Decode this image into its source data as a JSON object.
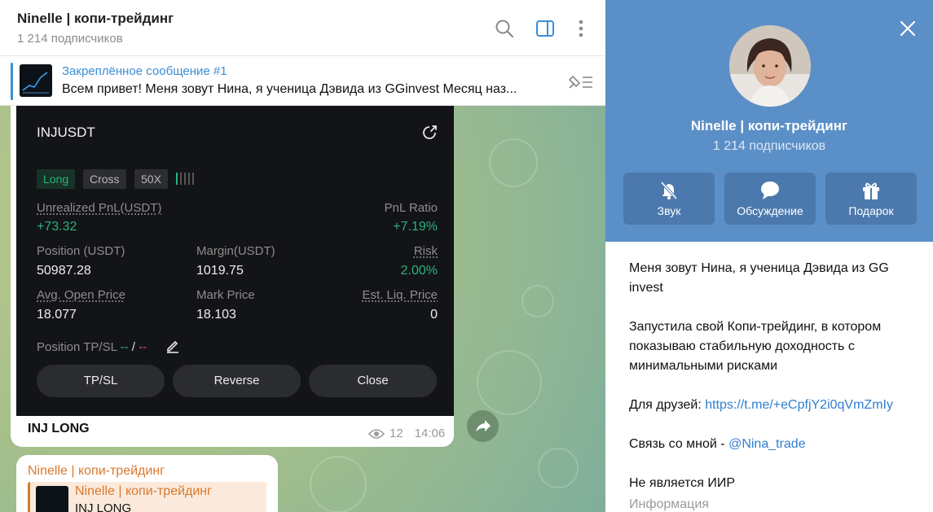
{
  "chat": {
    "title": "Ninelle | копи-трейдинг",
    "subscribers": "1 214 подписчиков"
  },
  "pinned": {
    "title": "Закреплённое сообщение #1",
    "text": "Всем привет! Меня зовут Нина, я ученица Дэвида из GGinvest   Месяц наз..."
  },
  "trade": {
    "symbol": "INJUSDT",
    "tags": [
      "Long",
      "Cross",
      "50X"
    ],
    "unrealized_label": "Unrealized PnL(USDT)",
    "unrealized_value": "+73.32",
    "pnl_ratio_label": "PnL Ratio",
    "pnl_ratio_value": "+7.19%",
    "position_label": "Position (USDT)",
    "position_value": "50987.28",
    "margin_label": "Margin(USDT)",
    "margin_value": "1019.75",
    "risk_label": "Risk",
    "risk_value": "2.00%",
    "avg_open_label": "Avg. Open Price",
    "avg_open_value": "18.077",
    "mark_label": "Mark Price",
    "mark_value": "18.103",
    "liq_label": "Est. Liq. Price",
    "liq_value": "0",
    "tpsl_label": "Position TP/SL",
    "tpsl_tp": "--",
    "tpsl_sep": "/",
    "tpsl_sl": "--",
    "buttons": [
      "TP/SL",
      "Reverse",
      "Close"
    ]
  },
  "message": {
    "caption": "INJ LONG",
    "views": "12",
    "time": "14:06"
  },
  "next_message": {
    "author": "Ninelle | копи-трейдинг",
    "reply_name": "Ninelle | копи-трейдинг",
    "reply_text": "INJ LONG"
  },
  "panel": {
    "name": "Ninelle | копи-трейдинг",
    "subscribers": "1 214 подписчиков",
    "buttons": [
      "Звук",
      "Обсуждение",
      "Подарок"
    ],
    "about1": "Меня зовут Нина, я ученица Дэвида из GG invest",
    "about2": "Запустила свой Копи-трейдинг, в котором показываю стабильную доходность с минимальными рисками",
    "friends_label": "Для друзей: ",
    "friends_link": "https://t.me/+eCpfjY2i0qVmZmIy",
    "contact_label": "Связь со мной - ",
    "contact_link": "@Nina_trade",
    "disclaimer": "Не является ИИР",
    "info_label": "Информация"
  },
  "colors": {
    "accent": "#3a8ed6",
    "panel_header": "#5b8fc7",
    "green": "#28b37d",
    "author": "#d9782d"
  }
}
